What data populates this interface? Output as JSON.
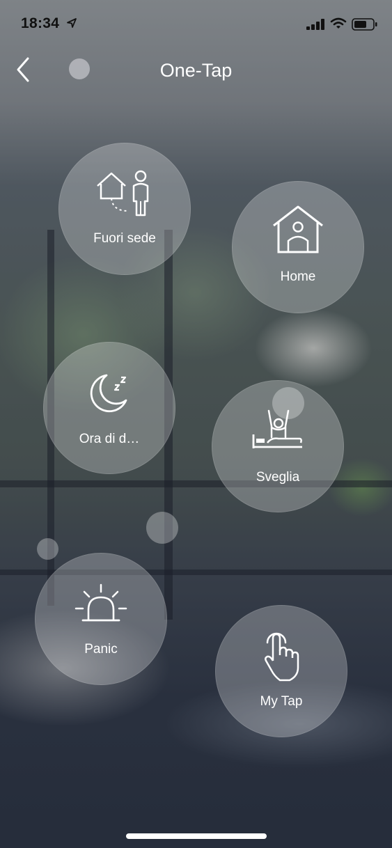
{
  "status_bar": {
    "time": "18:34"
  },
  "nav": {
    "title": "One-Tap"
  },
  "scenes": [
    {
      "label": "Fuori sede",
      "icon": "away-house-person-icon"
    },
    {
      "label": "Home",
      "icon": "home-person-icon"
    },
    {
      "label": "Ora di d…",
      "icon": "moon-sleep-icon"
    },
    {
      "label": "Sveglia",
      "icon": "wake-up-bed-icon"
    },
    {
      "label": "Panic",
      "icon": "alarm-siren-icon"
    },
    {
      "label": "My Tap",
      "icon": "tap-hand-icon"
    }
  ],
  "colors": {
    "bubble_fill": "rgba(255,255,255,0.26)",
    "text": "#ffffff"
  }
}
